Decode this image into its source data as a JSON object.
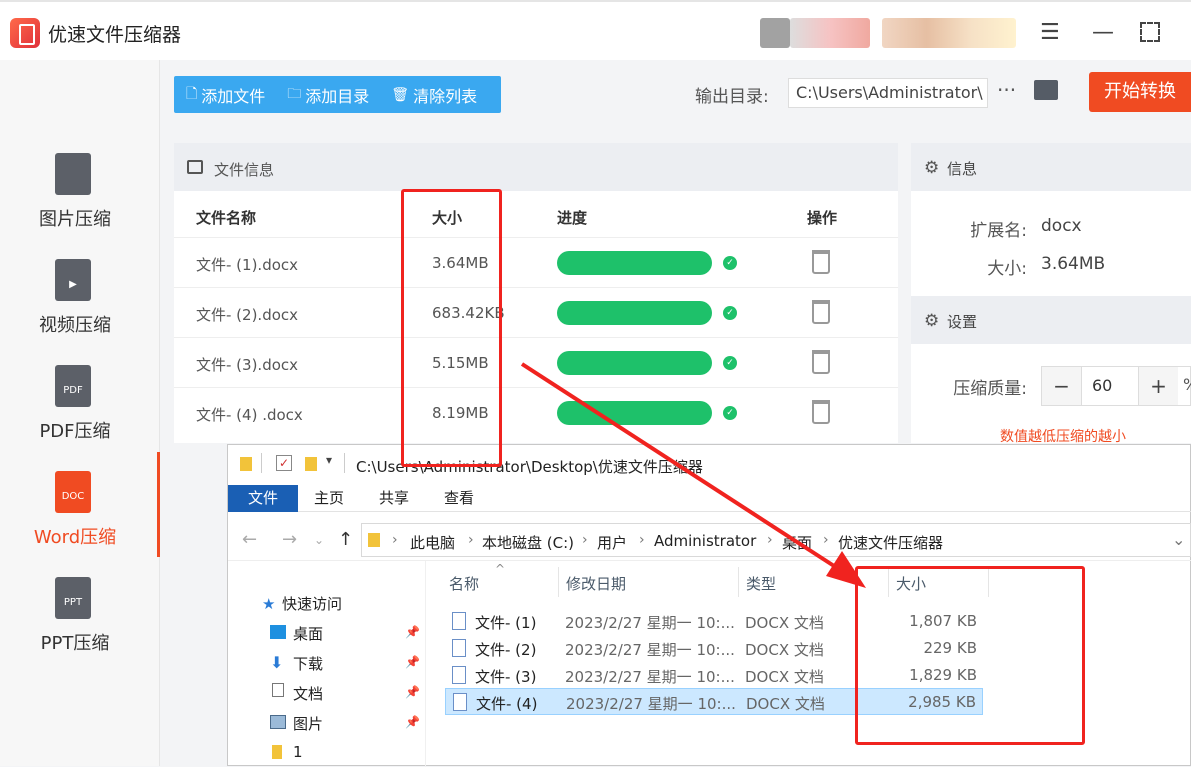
{
  "app": {
    "title": "优速文件压缩器"
  },
  "sidebar": {
    "items": [
      {
        "label": "图片压缩",
        "icon": "image-file-icon",
        "icon_text": ""
      },
      {
        "label": "视频压缩",
        "icon": "video-file-icon",
        "icon_text": "▶"
      },
      {
        "label": "PDF压缩",
        "icon": "pdf-file-icon",
        "icon_text": "PDF"
      },
      {
        "label": "Word压缩",
        "icon": "doc-file-icon",
        "icon_text": "DOC",
        "active": true
      },
      {
        "label": "PPT压缩",
        "icon": "ppt-file-icon",
        "icon_text": "PPT"
      }
    ]
  },
  "toolbar": {
    "add_file": "添加文件",
    "add_dir": "添加目录",
    "clear_list": "清除列表",
    "output_label": "输出目录:",
    "output_path": "C:\\Users\\Administrator\\",
    "more": "···",
    "start": "开始转换"
  },
  "file_panel": {
    "title": "文件信息",
    "columns": [
      "文件名称",
      "大小",
      "进度",
      "操作"
    ],
    "rows": [
      {
        "name": "文件- (1).docx",
        "size": "3.64MB",
        "progress": 1.0
      },
      {
        "name": "文件- (2).docx",
        "size": "683.42KB",
        "progress": 1.0
      },
      {
        "name": "文件- (3).docx",
        "size": "5.15MB",
        "progress": 1.0
      },
      {
        "name": "文件- (4) .docx",
        "size": "8.19MB",
        "progress": 1.0
      }
    ]
  },
  "info_panel": {
    "title": "信息",
    "ext_label": "扩展名:",
    "ext_value": "docx",
    "size_label": "大小:",
    "size_value": "3.64MB"
  },
  "settings_panel": {
    "title": "设置",
    "quality_label": "压缩质量:",
    "minus": "−",
    "quality_value": "60",
    "plus": "+",
    "unit": "%",
    "hint": "数值越低压缩的越小"
  },
  "explorer": {
    "path": "C:\\Users\\Administrator\\Desktop\\优速文件压缩器",
    "ribbon": [
      "文件",
      "主页",
      "共享",
      "查看"
    ],
    "breadcrumbs": [
      "此电脑",
      "本地磁盘 (C:)",
      "用户",
      "Administrator",
      "桌面",
      "优速文件压缩器"
    ],
    "nav": [
      {
        "label": "快速访问",
        "pinned": false
      },
      {
        "label": "桌面",
        "pinned": true
      },
      {
        "label": "下载",
        "pinned": true
      },
      {
        "label": "文档",
        "pinned": true
      },
      {
        "label": "图片",
        "pinned": true
      },
      {
        "label": "1",
        "pinned": false
      }
    ],
    "columns": [
      "名称",
      "修改日期",
      "类型",
      "大小"
    ],
    "files": [
      {
        "name": "文件- (1)",
        "date": "2023/2/27 星期一 10:...",
        "type": "DOCX 文档",
        "size": "1,807 KB"
      },
      {
        "name": "文件- (2)",
        "date": "2023/2/27 星期一 10:...",
        "type": "DOCX 文档",
        "size": "229 KB"
      },
      {
        "name": "文件- (3)",
        "date": "2023/2/27 星期一 10:...",
        "type": "DOCX 文档",
        "size": "1,829 KB"
      },
      {
        "name": "文件- (4)",
        "date": "2023/2/27 星期一 10:...",
        "type": "DOCX 文档",
        "size": "2,985 KB",
        "selected": true
      }
    ]
  },
  "colors": {
    "accent": "#f04b22",
    "toolbar": "#3aa8f0",
    "progress": "#1ec16a",
    "annotation": "#f0231f",
    "explorer_tab": "#1a5fb4"
  }
}
